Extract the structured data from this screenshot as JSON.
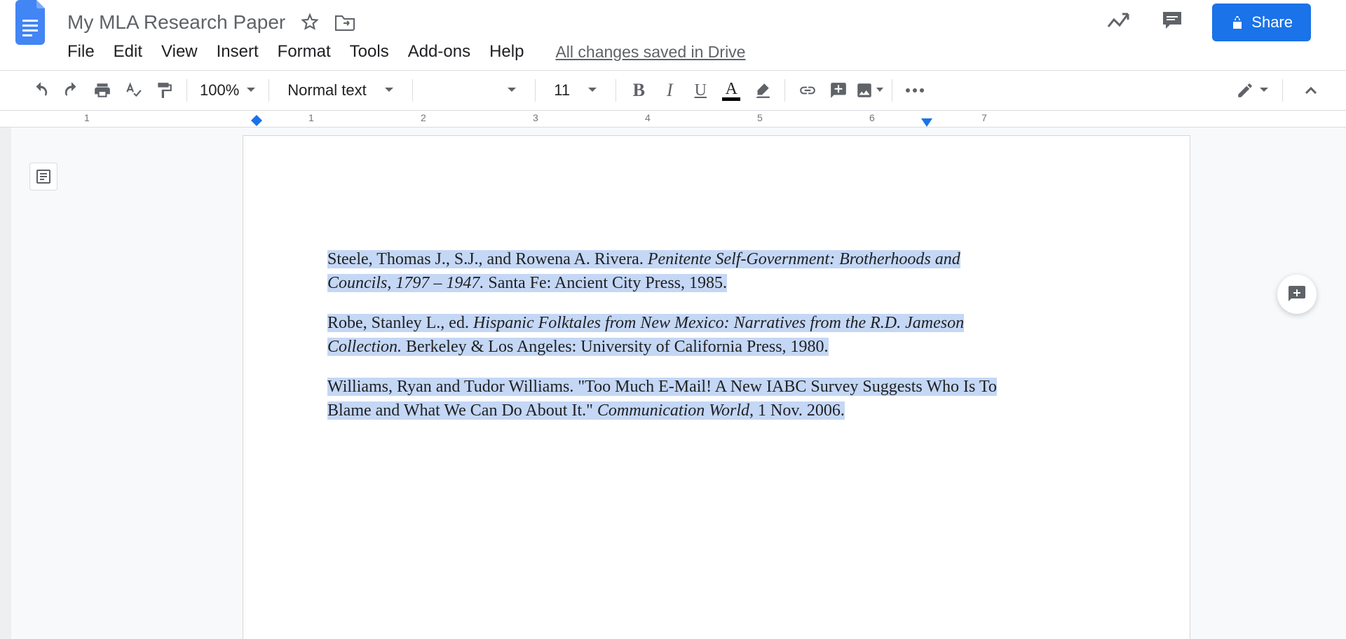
{
  "header": {
    "title": "My MLA Research Paper",
    "save_status": "All changes saved in Drive",
    "share_label": "Share"
  },
  "menu": {
    "file": "File",
    "edit": "Edit",
    "view": "View",
    "insert": "Insert",
    "format": "Format",
    "tools": "Tools",
    "addons": "Add-ons",
    "help": "Help"
  },
  "toolbar": {
    "zoom": "100%",
    "style": "Normal text",
    "font_size": "11",
    "bold": "B",
    "italic": "I",
    "underline": "U",
    "text_color": "A"
  },
  "ruler": {
    "numbers": [
      "1",
      "1",
      "2",
      "3",
      "4",
      "5",
      "6",
      "7"
    ]
  },
  "document": {
    "citations": [
      {
        "line1_plain": "Steele, Thomas J., S.J., and Rowena A. Rivera. ",
        "line1_italic": "Penitente Self-Government: Brotherhoods and",
        "line2_italic": "Councils, 1797 – 1947.",
        "line2_plain": " Santa Fe: Ancient City Press, 1985."
      },
      {
        "line1_plain": "Robe, Stanley L., ed. ",
        "line1_italic": "Hispanic Folktales from New Mexico: Narratives from the R.D. Jameson",
        "line2_italic": "Collection.",
        "line2_plain": " Berkeley & Los Angeles: University of California Press, 1980."
      },
      {
        "line1_plain": "Williams, Ryan and Tudor Williams. \"Too Much E-Mail! A New IABC Survey Suggests Who Is To",
        "line1_italic": "",
        "line2_plain_a": "Blame and What We Can Do About It.\" ",
        "line2_italic": "Communication World",
        "line2_plain_b": ", 1 Nov. 2006."
      }
    ]
  }
}
